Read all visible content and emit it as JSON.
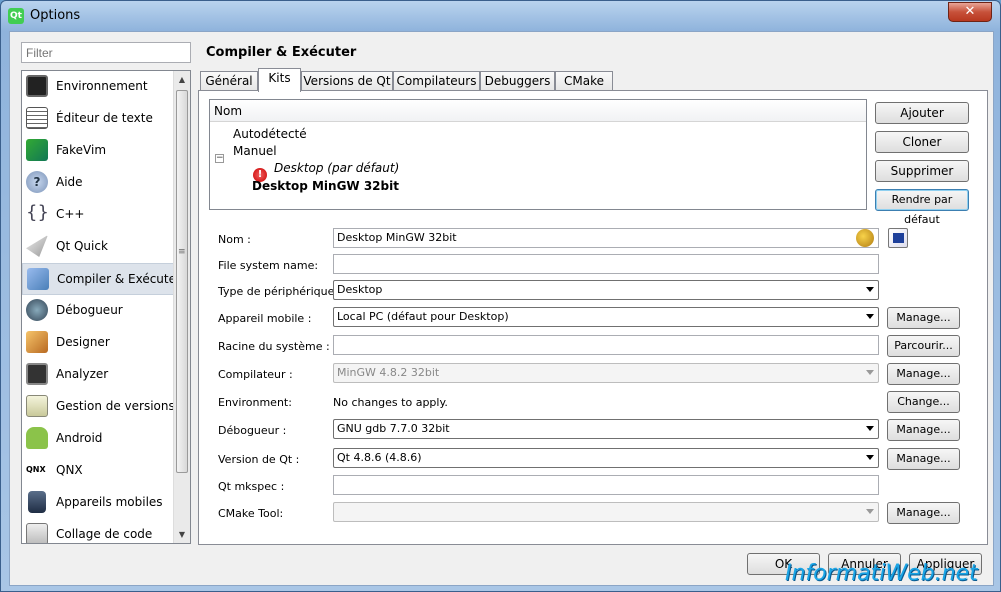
{
  "window": {
    "title": "Options",
    "close_label": "✕",
    "app_icon_label": "Qt"
  },
  "filter": {
    "placeholder": "Filter"
  },
  "sidebar": {
    "items": [
      {
        "label": "Environnement"
      },
      {
        "label": "Éditeur de texte"
      },
      {
        "label": "FakeVim"
      },
      {
        "label": "Aide"
      },
      {
        "label": "C++"
      },
      {
        "label": "Qt Quick"
      },
      {
        "label": "Compiler & Exécuter"
      },
      {
        "label": "Débogueur"
      },
      {
        "label": "Designer"
      },
      {
        "label": "Analyzer"
      },
      {
        "label": "Gestion de versions"
      },
      {
        "label": "Android"
      },
      {
        "label": "QNX"
      },
      {
        "label": "Appareils mobiles"
      },
      {
        "label": "Collage de code"
      }
    ],
    "selected": "Compiler & Exécuter",
    "scroll_up": "▲",
    "scroll_down": "▼",
    "grip": "≡"
  },
  "page": {
    "title": "Compiler & Exécuter"
  },
  "tabs": [
    {
      "label": "Général"
    },
    {
      "label": "Kits"
    },
    {
      "label": "Versions de Qt"
    },
    {
      "label": "Compilateurs"
    },
    {
      "label": "Debuggers"
    },
    {
      "label": "CMake"
    }
  ],
  "active_tab": "Kits",
  "kits_tree": {
    "header": "Nom",
    "autodetected": "Autodétecté",
    "manual": "Manuel",
    "manual_collapse": "−",
    "kit_default": "Desktop (par défaut)",
    "kit_mingw": "Desktop MinGW 32bit",
    "warn_glyph": "!"
  },
  "kit_buttons": {
    "add": "Ajouter",
    "clone": "Cloner",
    "remove": "Supprimer",
    "make_default": "Rendre par défaut"
  },
  "form": {
    "name_label": "Nom :",
    "name_value": "Desktop MinGW 32bit",
    "fs_name_label": "File system name:",
    "fs_name_value": "",
    "device_type_label": "Type de périphérique :",
    "device_type_value": "Desktop",
    "device_label": "Appareil mobile :",
    "device_value": "Local PC (défaut pour Desktop)",
    "device_manage": "Manage...",
    "sysroot_label": "Racine du système :",
    "sysroot_value": "",
    "sysroot_browse": "Parcourir...",
    "compiler_label": "Compilateur :",
    "compiler_value": "MinGW 4.8.2 32bit",
    "compiler_manage": "Manage...",
    "env_label": "Environment:",
    "env_value": "No changes to apply.",
    "env_change": "Change...",
    "debugger_label": "Débogueur :",
    "debugger_value": "GNU gdb 7.7.0 32bit",
    "debugger_manage": "Manage...",
    "qt_label": "Version de Qt :",
    "qt_value": "Qt 4.8.6 (4.8.6)",
    "qt_manage": "Manage...",
    "mkspec_label": "Qt mkspec :",
    "mkspec_value": "",
    "cmake_label": "CMake Tool:",
    "cmake_value": "",
    "cmake_manage": "Manage..."
  },
  "dialog_buttons": {
    "ok": "OK",
    "cancel": "Annuler",
    "apply": "Appliquer"
  },
  "watermark": "InformatiWeb.net"
}
